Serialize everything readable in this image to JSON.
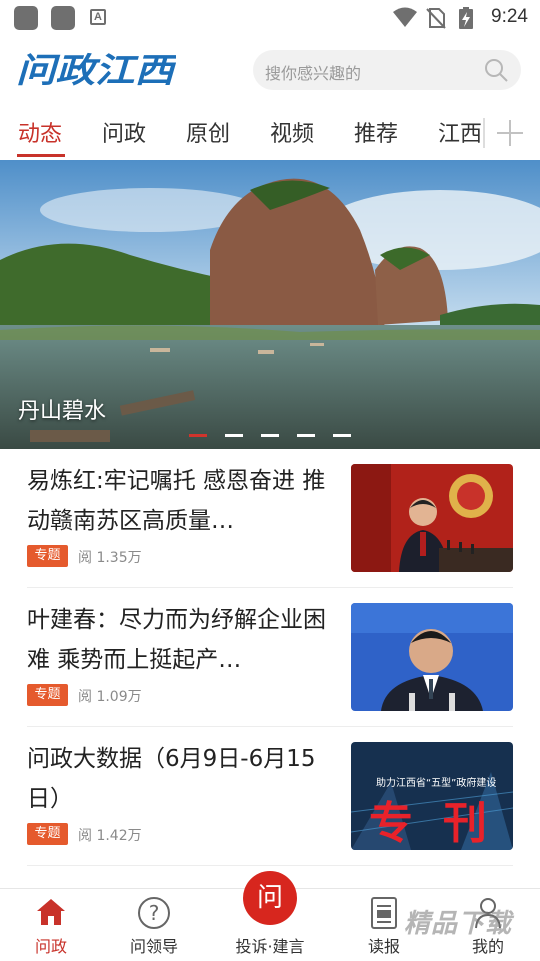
{
  "status_bar": {
    "time": "9:24",
    "notification_icon": "A"
  },
  "header": {
    "logo_text": "问政江西",
    "search_placeholder": "搜你感兴趣的"
  },
  "tabs": [
    "动态",
    "问政",
    "原创",
    "视频",
    "推荐",
    "江西"
  ],
  "banner": {
    "caption": "丹山碧水",
    "slide_count": 5,
    "active_slide": 0
  },
  "news": [
    {
      "title": "易炼红:牢记嘱托 感恩奋进 推动赣南苏区高质量…",
      "tag": "专题",
      "views": "阅 1.35万"
    },
    {
      "title": "叶建春：尽力而为纾解企业困难 乘势而上挺起产…",
      "tag": "专题",
      "views": "阅 1.09万"
    },
    {
      "title": "问政大数据（6月9日-6月15日）",
      "tag": "专题",
      "views": "阅 1.42万",
      "image_text": {
        "banner": "助力江西省“五型”政府建设",
        "big": "专刊"
      }
    }
  ],
  "bottom_nav": [
    {
      "label": "问政",
      "icon": "home-icon",
      "active": true
    },
    {
      "label": "问领导",
      "icon": "question-icon",
      "active": false
    },
    {
      "label": "投诉·建言",
      "icon": "complaint-icon",
      "center_glyph": "问",
      "active": false
    },
    {
      "label": "读报",
      "icon": "newspaper-icon",
      "active": false
    },
    {
      "label": "我的",
      "icon": "user-icon",
      "active": false
    }
  ],
  "watermark": "精品下载",
  "colors": {
    "brand_red": "#c8322a",
    "tag_orange": "#e55a2d",
    "logo_blue": "#1d6fb8"
  }
}
